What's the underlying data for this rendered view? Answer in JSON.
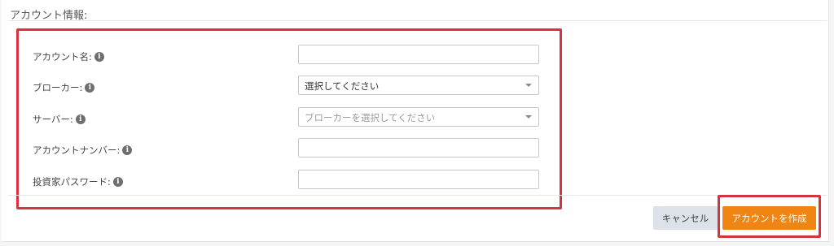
{
  "section": {
    "title": "アカウント情報:"
  },
  "form": {
    "fields": [
      {
        "label": "アカウント名:",
        "type": "text",
        "value": ""
      },
      {
        "label": "ブローカー:",
        "type": "select",
        "value": "選択してください"
      },
      {
        "label": "サーバー:",
        "type": "select",
        "value": "ブローカーを選択してください",
        "disabled": true
      },
      {
        "label": "アカウントナンバー:",
        "type": "text",
        "value": ""
      },
      {
        "label": "投資家パスワード:",
        "type": "password",
        "value": ""
      }
    ],
    "info_icon_glyph": "i"
  },
  "actions": {
    "cancel_label": "キャンセル",
    "create_label": "アカウントを作成"
  },
  "colors": {
    "accent": "#f08513",
    "highlight": "#d7323f",
    "cancel_bg": "#dde2e8"
  }
}
